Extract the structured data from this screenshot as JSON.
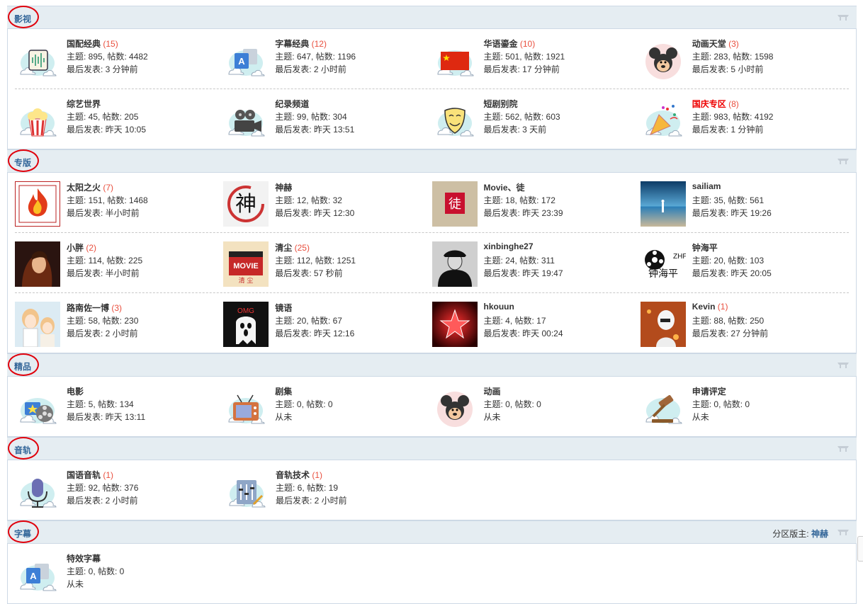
{
  "sections": [
    {
      "title": "影视",
      "rows": [
        [
          {
            "name": "国配经典",
            "count": "(15)",
            "stats": "主题: 895, 帖数: 4482",
            "last": "最后发表: 3 分钟前",
            "icon": "audio-wave-icon"
          },
          {
            "name": "字幕经典",
            "count": "(12)",
            "stats": "主题: 647, 帖数: 1196",
            "last": "最后发表: 2 小时前",
            "icon": "translate-icon"
          },
          {
            "name": "华语鎏金",
            "count": "(10)",
            "stats": "主题: 501, 帖数: 1921",
            "last": "最后发表: 17 分钟前",
            "icon": "china-flag-icon"
          },
          {
            "name": "动画天堂",
            "count": "(3)",
            "stats": "主题: 283, 帖数: 1598",
            "last": "最后发表: 5 小时前",
            "icon": "mickey-icon"
          }
        ],
        [
          {
            "name": "综艺世界",
            "count": "",
            "stats": "主题: 45, 帖数: 205",
            "last": "最后发表: 昨天 10:05",
            "icon": "popcorn-icon"
          },
          {
            "name": "纪录频道",
            "count": "",
            "stats": "主题: 99, 帖数: 304",
            "last": "最后发表: 昨天 13:51",
            "icon": "film-camera-icon"
          },
          {
            "name": "短剧别院",
            "count": "",
            "stats": "主题: 562, 帖数: 603",
            "last": "最后发表: 3 天前",
            "icon": "theater-mask-icon"
          },
          {
            "name": "国庆专区",
            "count": "(8)",
            "stats": "主题: 983, 帖数: 4192",
            "last": "最后发表: 1 分钟前",
            "icon": "party-popper-icon",
            "highlight": true
          }
        ]
      ]
    },
    {
      "title": "专版",
      "rows": [
        [
          {
            "name": "太阳之火",
            "count": "(7)",
            "stats": "主题: 151, 帖数: 1468",
            "last": "最后发表: 半小时前",
            "icon": "fire-logo-icon",
            "square": true
          },
          {
            "name": "神赫",
            "count": "",
            "stats": "主题: 12, 帖数: 32",
            "last": "最后发表: 昨天 12:30",
            "icon": "calligraphy-avatar-icon",
            "square": true
          },
          {
            "name": "Movie、徒",
            "count": "",
            "stats": "主题: 18, 帖数: 172",
            "last": "最后发表: 昨天 23:39",
            "icon": "seal-avatar-icon",
            "square": true
          },
          {
            "name": "sailiam",
            "count": "",
            "stats": "主题: 35, 帖数: 561",
            "last": "最后发表: 昨天 19:26",
            "icon": "beach-photo-icon",
            "square": true
          }
        ],
        [
          {
            "name": "小胖",
            "count": "(2)",
            "stats": "主题: 114, 帖数: 225",
            "last": "最后发表: 半小时前",
            "icon": "portrait-photo-icon",
            "square": true
          },
          {
            "name": "清尘",
            "count": "(25)",
            "stats": "主题: 112, 帖数: 1251",
            "last": "最后发表: 57 秒前",
            "icon": "movie-clapper-avatar-icon",
            "square": true
          },
          {
            "name": "xinbinghe27",
            "count": "",
            "stats": "主题: 24, 帖数: 311",
            "last": "最后发表: 昨天 19:47",
            "icon": "officer-photo-icon",
            "square": true
          },
          {
            "name": "钟海平",
            "count": "",
            "stats": "主题: 20, 帖数: 103",
            "last": "最后发表: 昨天 20:05",
            "icon": "film-reel-avatar-icon",
            "square": true
          }
        ],
        [
          {
            "name": "路南佐一博",
            "count": "(3)",
            "stats": "主题: 58, 帖数: 230",
            "last": "最后发表: 2 小时前",
            "icon": "anime-avatar-icon",
            "square": true
          },
          {
            "name": "镜语",
            "count": "",
            "stats": "主题: 20, 帖数: 67",
            "last": "最后发表: 昨天 12:16",
            "icon": "ghost-avatar-icon",
            "square": true
          },
          {
            "name": "hkouun",
            "count": "",
            "stats": "主题: 4, 帖数: 17",
            "last": "最后发表: 昨天 00:24",
            "icon": "red-star-avatar-icon",
            "square": true
          },
          {
            "name": "Kevin",
            "count": "(1)",
            "stats": "主题: 88, 帖数: 250",
            "last": "最后发表: 27 分钟前",
            "icon": "stormtrooper-avatar-icon",
            "square": true
          }
        ]
      ]
    },
    {
      "title": "精品",
      "rows": [
        [
          {
            "name": "电影",
            "count": "",
            "stats": "主题: 5, 帖数: 134",
            "last": "最后发表: 昨天 13:11",
            "icon": "film-reel-icon"
          },
          {
            "name": "剧集",
            "count": "",
            "stats": "主题: 0, 帖数: 0",
            "last": "从未",
            "icon": "tv-icon"
          },
          {
            "name": "动画",
            "count": "",
            "stats": "主题: 0, 帖数: 0",
            "last": "从未",
            "icon": "mickey-icon"
          },
          {
            "name": "申请评定",
            "count": "",
            "stats": "主题: 0, 帖数: 0",
            "last": "从未",
            "icon": "gavel-icon"
          }
        ]
      ]
    },
    {
      "title": "音轨",
      "rows": [
        [
          {
            "name": "国语音轨",
            "count": "(1)",
            "stats": "主题: 92, 帖数: 376",
            "last": "最后发表: 2 小时前",
            "icon": "microphone-icon"
          },
          {
            "name": "音轨技术",
            "count": "(1)",
            "stats": "主题: 6, 帖数: 19",
            "last": "最后发表: 2 小时前",
            "icon": "audio-tech-icon"
          }
        ]
      ]
    },
    {
      "title": "字幕",
      "moderator_label": "分区版主:",
      "moderator_name": "神赫",
      "rows": [
        [
          {
            "name": "特效字幕",
            "count": "",
            "stats": "主题: 0, 帖数: 0",
            "last": "从未",
            "icon": "translate-icon"
          }
        ]
      ]
    }
  ]
}
